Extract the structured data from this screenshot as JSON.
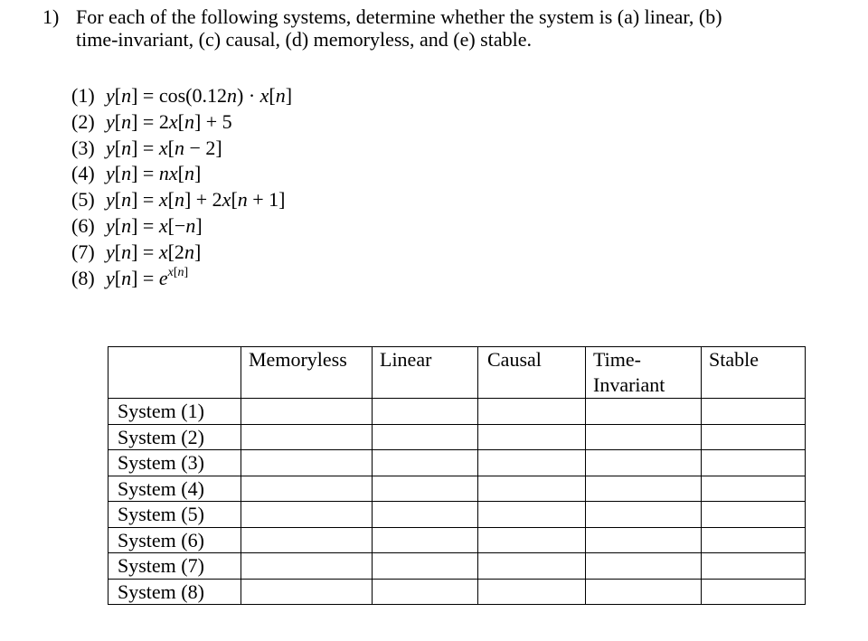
{
  "question": {
    "number": "1)",
    "line1": "For each of the following systems, determine whether the system is (a) linear, (b)",
    "line2": "time-invariant, (c) causal, (d) memoryless, and (e) stable."
  },
  "systems": [
    {
      "index": "(1)",
      "lhs": "y[n]",
      "rhs": "cos(0.12n) · x[n]",
      "parts": {
        "a": "cos(0.12",
        "n": "n",
        "b": ") · ",
        "x": "x",
        "c": "[",
        "n2": "n",
        "d": "]"
      }
    },
    {
      "index": "(2)",
      "lhs": "y[n]",
      "rhs": "2x[n] + 5",
      "parts": {
        "a": "2",
        "x": "x",
        "b": "[",
        "n": "n",
        "c": "] + 5"
      }
    },
    {
      "index": "(3)",
      "lhs": "y[n]",
      "rhs": "x[n − 2]",
      "parts": {
        "x": "x",
        "a": "[",
        "n": "n",
        "b": " − 2]"
      }
    },
    {
      "index": "(4)",
      "lhs": "y[n]",
      "rhs": "nx[n]",
      "parts": {
        "nx": "nx",
        "a": "[",
        "n": "n",
        "b": "]"
      }
    },
    {
      "index": "(5)",
      "lhs": "y[n]",
      "rhs": "x[n] + 2x[n + 1]",
      "parts": {
        "x": "x",
        "a": "[",
        "n": "n",
        "b": "] + 2",
        "x2": "x",
        "c": "[",
        "n2": "n",
        "d": " + 1]"
      }
    },
    {
      "index": "(6)",
      "lhs": "y[n]",
      "rhs": "x[−n]",
      "parts": {
        "x": "x",
        "a": "[−",
        "n": "n",
        "b": "]"
      }
    },
    {
      "index": "(7)",
      "lhs": "y[n]",
      "rhs": "x[2n]",
      "parts": {
        "x": "x",
        "a": "[2",
        "n": "n",
        "b": "]"
      }
    },
    {
      "index": "(8)",
      "lhs": "y[n]",
      "rhs": "e^{x[n]}",
      "parts": {
        "e": "e",
        "sup_x": "x",
        "sup_a": "[",
        "sup_n": "n",
        "sup_b": "]"
      }
    }
  ],
  "lhs_parts": {
    "y": "y",
    "open": "[",
    "n": "n",
    "close": "]",
    "eq": " = "
  },
  "table": {
    "corner": "",
    "headers": [
      "Memoryless",
      "Linear",
      "Causal",
      "Time-\nInvariant",
      "Stable"
    ],
    "header_line1": [
      "Memoryless",
      "Linear",
      "Causal",
      "Time-",
      "Stable"
    ],
    "header_line2": [
      "",
      "",
      "",
      "Invariant",
      ""
    ],
    "rows": [
      {
        "label": "System (1)",
        "cells": [
          "",
          "",
          "",
          "",
          ""
        ]
      },
      {
        "label": "System (2)",
        "cells": [
          "",
          "",
          "",
          "",
          ""
        ]
      },
      {
        "label": "System (3)",
        "cells": [
          "",
          "",
          "",
          "",
          ""
        ]
      },
      {
        "label": "System (4)",
        "cells": [
          "",
          "",
          "",
          "",
          ""
        ]
      },
      {
        "label": "System (5)",
        "cells": [
          "",
          "",
          "",
          "",
          ""
        ]
      },
      {
        "label": "System (6)",
        "cells": [
          "",
          "",
          "",
          "",
          ""
        ]
      },
      {
        "label": "System (7)",
        "cells": [
          "",
          "",
          "",
          "",
          ""
        ]
      },
      {
        "label": "System (8)",
        "cells": [
          "",
          "",
          "",
          "",
          ""
        ]
      }
    ]
  }
}
